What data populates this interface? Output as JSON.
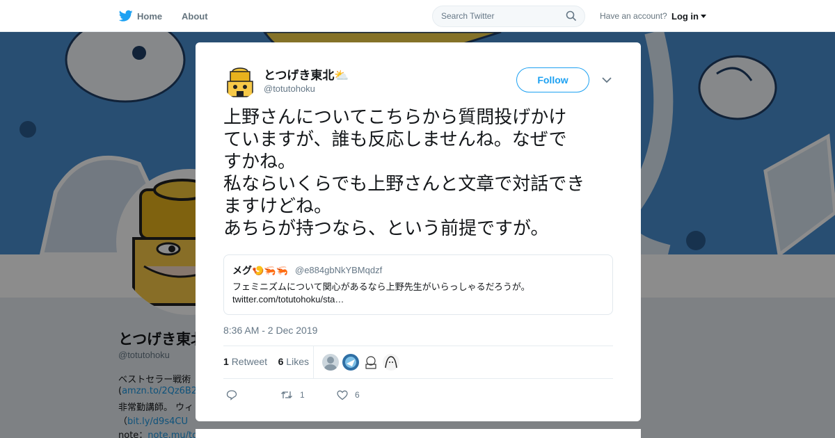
{
  "nav": {
    "home_label": "Home",
    "about_label": "About",
    "search_placeholder": "Search Twitter",
    "account_prompt": "Have an account?",
    "login_label": "Log in"
  },
  "profile": {
    "name": "とつげき東北",
    "handle": "@totutohoku",
    "bio_lines": [
      {
        "text": "ベストセラー戦術",
        "link": ""
      },
      {
        "text": "(",
        "link": "amzn.to/2Qz6B2"
      },
      {
        "text": "非常勤講師。 ウィ",
        "link": ""
      },
      {
        "text": "（",
        "link": "bit.ly/d9s4CU"
      },
      {
        "text": "note：",
        "link": "note.mu/to"
      }
    ]
  },
  "tweet": {
    "author_name": "とつげき東北",
    "author_emoji": "⛅",
    "author_handle": "@totutohoku",
    "follow_label": "Follow",
    "text_lines": [
      "上野さんについてこちらから質問投げかけ",
      "ていますが、誰も反応しませんね。なぜで",
      "すかね。",
      "私ならいくらでも上野さんと文章で対話でき",
      "ますけどね。",
      "あちらが持つなら、という前提ですが。"
    ],
    "quote": {
      "name": "メグ🍤🦐🦐",
      "handle": "@e884gbNkYBMqdzf",
      "text": "フェミニズムについて関心があるなら上野先生がいらっしゃるだろうが。",
      "link": "twitter.com/totutohoku/sta…"
    },
    "timestamp": "8:36 AM - 2 Dec 2019",
    "retweets_count": "1",
    "retweets_label": "Retweet",
    "likes_count": "6",
    "likes_label": "Likes",
    "actions": {
      "reply_count": "",
      "retweet_count": "1",
      "like_count": "6"
    }
  },
  "colors": {
    "accent": "#1da1f2",
    "banner": "#4a8fd0",
    "link": "#1b95e0"
  }
}
